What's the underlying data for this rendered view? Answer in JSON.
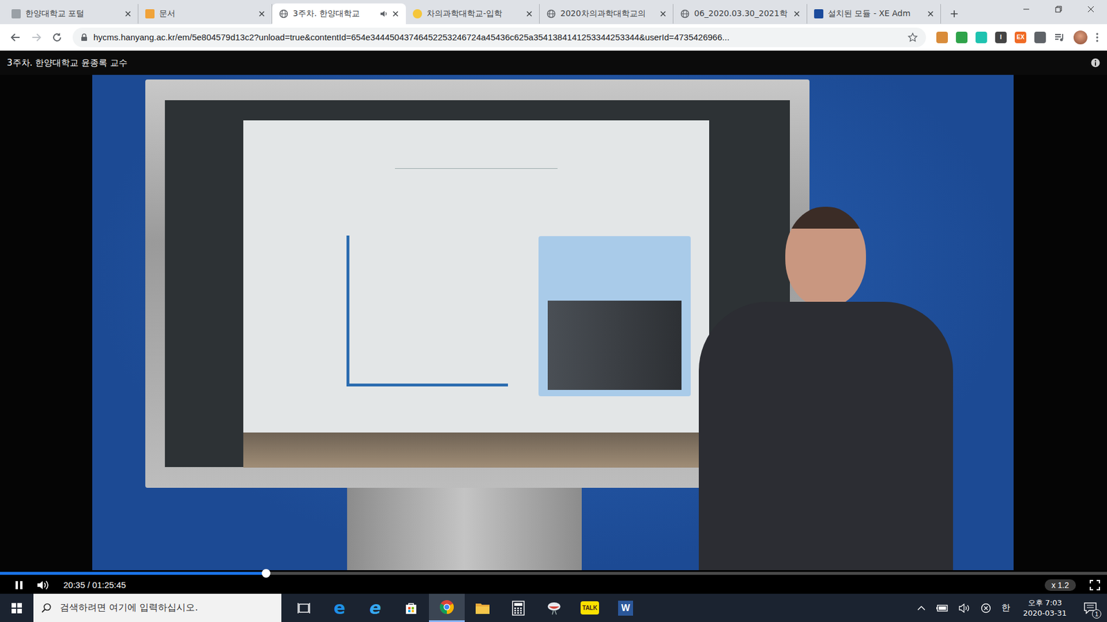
{
  "browser": {
    "tabs": [
      {
        "label": "한양대학교 포털",
        "selected": false,
        "audio": false,
        "kind": "portal"
      },
      {
        "label": "문서",
        "selected": false,
        "audio": false,
        "kind": "doc"
      },
      {
        "label": "3주차. 한양대학교",
        "selected": true,
        "audio": true,
        "kind": "globe"
      },
      {
        "label": "차의과학대학교-입학",
        "selected": false,
        "audio": false,
        "kind": "cha"
      },
      {
        "label": "2020차의과학대학교의",
        "selected": false,
        "audio": false,
        "kind": "globe"
      },
      {
        "label": "06_2020.03.30_2021학",
        "selected": false,
        "audio": false,
        "kind": "globe"
      },
      {
        "label": "설치된 모듈 - XE Adm",
        "selected": false,
        "audio": false,
        "kind": "xe"
      }
    ],
    "url": "hycms.hanyang.ac.kr/em/5e804579d13c2?unload=true&contentId=654e34445043746452253246724a45436c625a3541384141253344253344&userId=4735426966...",
    "bookmarked": false,
    "extensions": [
      {
        "color": "#d98c3a",
        "label": ""
      },
      {
        "color": "#2fa34a",
        "label": ""
      },
      {
        "color": "#1ec3b0",
        "label": ""
      },
      {
        "color": "#444444",
        "label": "I"
      },
      {
        "color": "#f06a25",
        "label": "EX"
      },
      {
        "color": "#5f6368",
        "label": ""
      }
    ]
  },
  "player": {
    "title": "3주차. 한양대학교 윤종록 교수",
    "playing": true,
    "muted": false,
    "progress": 0.24,
    "time": "20:35 / 01:25:45",
    "speed": "x 1.2"
  },
  "taskbar": {
    "search_placeholder": "검색하려면 여기에 입력하십시오.",
    "apps": [
      {
        "kind": "task-view",
        "label": "",
        "active": false
      },
      {
        "kind": "edge",
        "label": "e",
        "active": false
      },
      {
        "kind": "ie",
        "label": "e",
        "active": false
      },
      {
        "kind": "store",
        "label": "",
        "active": false
      },
      {
        "kind": "chrome",
        "label": "",
        "active": true
      },
      {
        "kind": "explorer",
        "label": "",
        "active": false
      },
      {
        "kind": "calculator",
        "label": "",
        "active": false
      },
      {
        "kind": "app",
        "label": "",
        "active": false
      },
      {
        "kind": "kakaotalk",
        "label": "TALK",
        "active": false
      },
      {
        "kind": "word",
        "label": "W",
        "active": false
      }
    ],
    "ime": "한",
    "time": "오후 7:03",
    "date": "2020-03-31",
    "notifications": "1"
  }
}
